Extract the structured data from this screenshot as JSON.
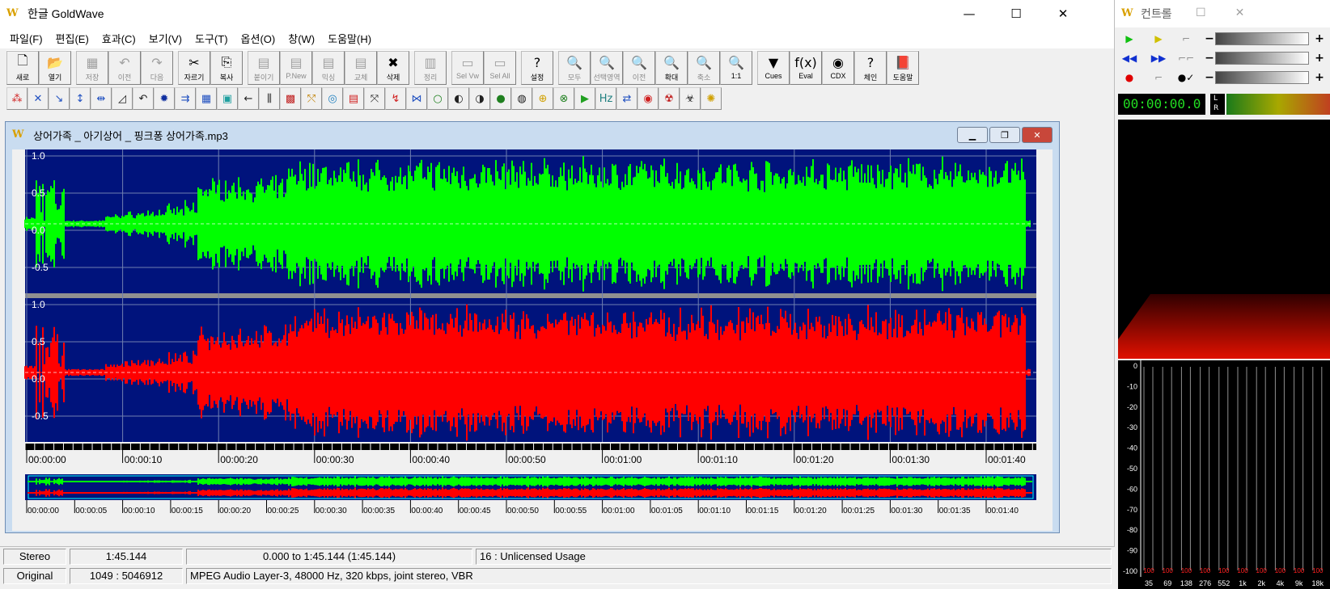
{
  "app": {
    "title": "한글 GoldWave",
    "logo": "W"
  },
  "menu": [
    "파일(F)",
    "편집(E)",
    "효과(C)",
    "보기(V)",
    "도구(T)",
    "옵션(O)",
    "창(W)",
    "도움말(H)"
  ],
  "toolbar1": [
    {
      "label": "새로",
      "icon": "new-file-icon",
      "glyph": "🗋",
      "enabled": true
    },
    {
      "label": "열기",
      "icon": "open-folder-icon",
      "glyph": "📂",
      "enabled": true
    },
    {
      "label": "저장",
      "icon": "save-disk-icon",
      "glyph": "▦",
      "enabled": false
    },
    {
      "label": "이전",
      "icon": "undo-icon",
      "glyph": "↶",
      "enabled": false
    },
    {
      "label": "다음",
      "icon": "redo-icon",
      "glyph": "↷",
      "enabled": false
    },
    {
      "label": "자르기",
      "icon": "cut-scissors-icon",
      "glyph": "✂",
      "enabled": true
    },
    {
      "label": "복사",
      "icon": "copy-icon",
      "glyph": "⎘",
      "enabled": true
    },
    {
      "label": "붙이기",
      "icon": "paste-icon",
      "glyph": "▤",
      "enabled": false
    },
    {
      "label": "P.New",
      "icon": "paste-new-icon",
      "glyph": "▤",
      "enabled": false
    },
    {
      "label": "믹싱",
      "icon": "mix-icon",
      "glyph": "▤",
      "enabled": false
    },
    {
      "label": "교체",
      "icon": "replace-icon",
      "glyph": "▤",
      "enabled": false
    },
    {
      "label": "삭제",
      "icon": "delete-icon",
      "glyph": "✖",
      "enabled": true
    },
    {
      "label": "정리",
      "icon": "trim-icon",
      "glyph": "▥",
      "enabled": false
    },
    {
      "label": "Sel Vw",
      "icon": "select-view-icon",
      "glyph": "▭",
      "enabled": false
    },
    {
      "label": "Sel All",
      "icon": "select-all-icon",
      "glyph": "▭",
      "enabled": false
    },
    {
      "label": "설정",
      "icon": "set-icon",
      "glyph": "?",
      "enabled": true
    },
    {
      "label": "모두",
      "icon": "zoom-all-icon",
      "glyph": "🔍",
      "enabled": false
    },
    {
      "label": "선택영역",
      "icon": "zoom-selection-icon",
      "glyph": "🔍",
      "enabled": false
    },
    {
      "label": "이전",
      "icon": "zoom-previous-icon",
      "glyph": "🔍",
      "enabled": false
    },
    {
      "label": "확대",
      "icon": "zoom-in-icon",
      "glyph": "🔍",
      "enabled": true
    },
    {
      "label": "축소",
      "icon": "zoom-out-icon",
      "glyph": "🔍",
      "enabled": false
    },
    {
      "label": "1:1",
      "icon": "zoom-1to1-icon",
      "glyph": "🔍",
      "enabled": true
    },
    {
      "label": "Cues",
      "icon": "cues-icon",
      "glyph": "▼",
      "enabled": true
    },
    {
      "label": "Eval",
      "icon": "eval-fx-icon",
      "glyph": "f(x)",
      "enabled": true
    },
    {
      "label": "CDX",
      "icon": "cd-extract-icon",
      "glyph": "◉",
      "enabled": true
    },
    {
      "label": "체인",
      "icon": "chain-help-icon",
      "glyph": "?",
      "enabled": true
    },
    {
      "label": "도움말",
      "icon": "help-book-icon",
      "glyph": "📕",
      "enabled": true
    }
  ],
  "toolbar2_icons": [
    "effect-1-icon",
    "effect-2-icon",
    "effect-3-icon",
    "effect-4-icon",
    "effect-5-icon",
    "effect-6-icon",
    "effect-7-icon",
    "effect-8-icon",
    "effect-9-icon",
    "effect-10-icon",
    "effect-11-icon",
    "effect-12-icon",
    "effect-13-icon",
    "effect-14-icon",
    "effect-15-icon",
    "effect-16-icon",
    "effect-17-icon",
    "effect-18-icon",
    "effect-19-icon",
    "effect-20-icon",
    "effect-21-icon",
    "effect-22-icon",
    "effect-23-icon",
    "effect-24-icon",
    "effect-25-icon",
    "effect-26-icon",
    "effect-27-icon",
    "effect-28-icon",
    "effect-29-icon",
    "effect-30-icon",
    "effect-31-icon",
    "effect-32-icon",
    "effect-33-icon",
    "effect-34-icon"
  ],
  "document": {
    "title": "상어가족 _ 아기상어 _ 핑크퐁 상어가족.mp3"
  },
  "waveform": {
    "left_color": "#00ff00",
    "right_color": "#ff0000",
    "background": "#00137c",
    "y_ticks": [
      "1.0",
      "0.5",
      "0.0",
      "-0.5"
    ],
    "time_labels": [
      "00:00:00",
      "00:00:10",
      "00:00:20",
      "00:00:30",
      "00:00:40",
      "00:00:50",
      "00:01:00",
      "00:01:10",
      "00:01:20",
      "00:01:30",
      "00:01:40"
    ],
    "overview_labels": [
      "00:00:00",
      "00:00:05",
      "00:00:10",
      "00:00:15",
      "00:00:20",
      "00:00:25",
      "00:00:30",
      "00:00:35",
      "00:00:40",
      "00:00:45",
      "00:00:50",
      "00:00:55",
      "00:01:00",
      "00:01:05",
      "00:01:10",
      "00:01:15",
      "00:01:20",
      "00:01:25",
      "00:01:30",
      "00:01:35",
      "00:01:40"
    ]
  },
  "status": {
    "channels": "Stereo",
    "length": "1:45.144",
    "selection": "0.000 to 1:45.144 (1:45.144)",
    "license": "16 : Unlicensed Usage",
    "mode": "Original",
    "samples": "1049 : 5046912",
    "format": "MPEG Audio Layer-3, 48000 Hz, 320 kbps, joint stereo, VBR"
  },
  "control": {
    "title": "컨트롤",
    "time": "00:00:00.0",
    "vu_labels": [
      "L",
      "R"
    ],
    "spectrum_db": [
      "0",
      "-10",
      "-20",
      "-30",
      "-40",
      "-50",
      "-60",
      "-70",
      "-80",
      "-90",
      "-100"
    ],
    "spectrum_freq": [
      "35",
      "69",
      "138",
      "276",
      "552",
      "1k",
      "2k",
      "4k",
      "9k",
      "18k"
    ],
    "spectrum_peak": "100"
  }
}
